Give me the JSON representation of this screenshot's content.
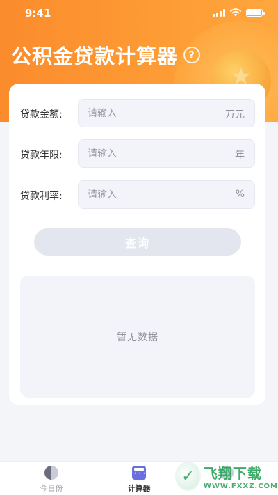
{
  "status_bar": {
    "time": "9:41"
  },
  "header": {
    "title": "公积金贷款计算器",
    "help_icon": "question-circle-icon"
  },
  "form": {
    "fields": [
      {
        "label": "贷款金额:",
        "placeholder": "请输入",
        "unit": "万元"
      },
      {
        "label": "贷款年限:",
        "placeholder": "请输入",
        "unit": "年"
      },
      {
        "label": "贷款利率:",
        "placeholder": "请输入",
        "unit": "%"
      }
    ],
    "query_label": "查询"
  },
  "result": {
    "empty_text": "暂无数据"
  },
  "tabbar": {
    "items": [
      {
        "label": "今日份",
        "icon": "half-moon-icon",
        "active": false
      },
      {
        "label": "计算器",
        "icon": "calculator-icon",
        "active": true
      }
    ]
  },
  "watermark": {
    "cn": "飞翔下载",
    "en": "WWW.FXXZ.COM"
  },
  "colors": {
    "accent_orange": "#fd9b34",
    "button_disabled": "#e3e6ef",
    "tab_active_icon": "#6a6fe0"
  }
}
